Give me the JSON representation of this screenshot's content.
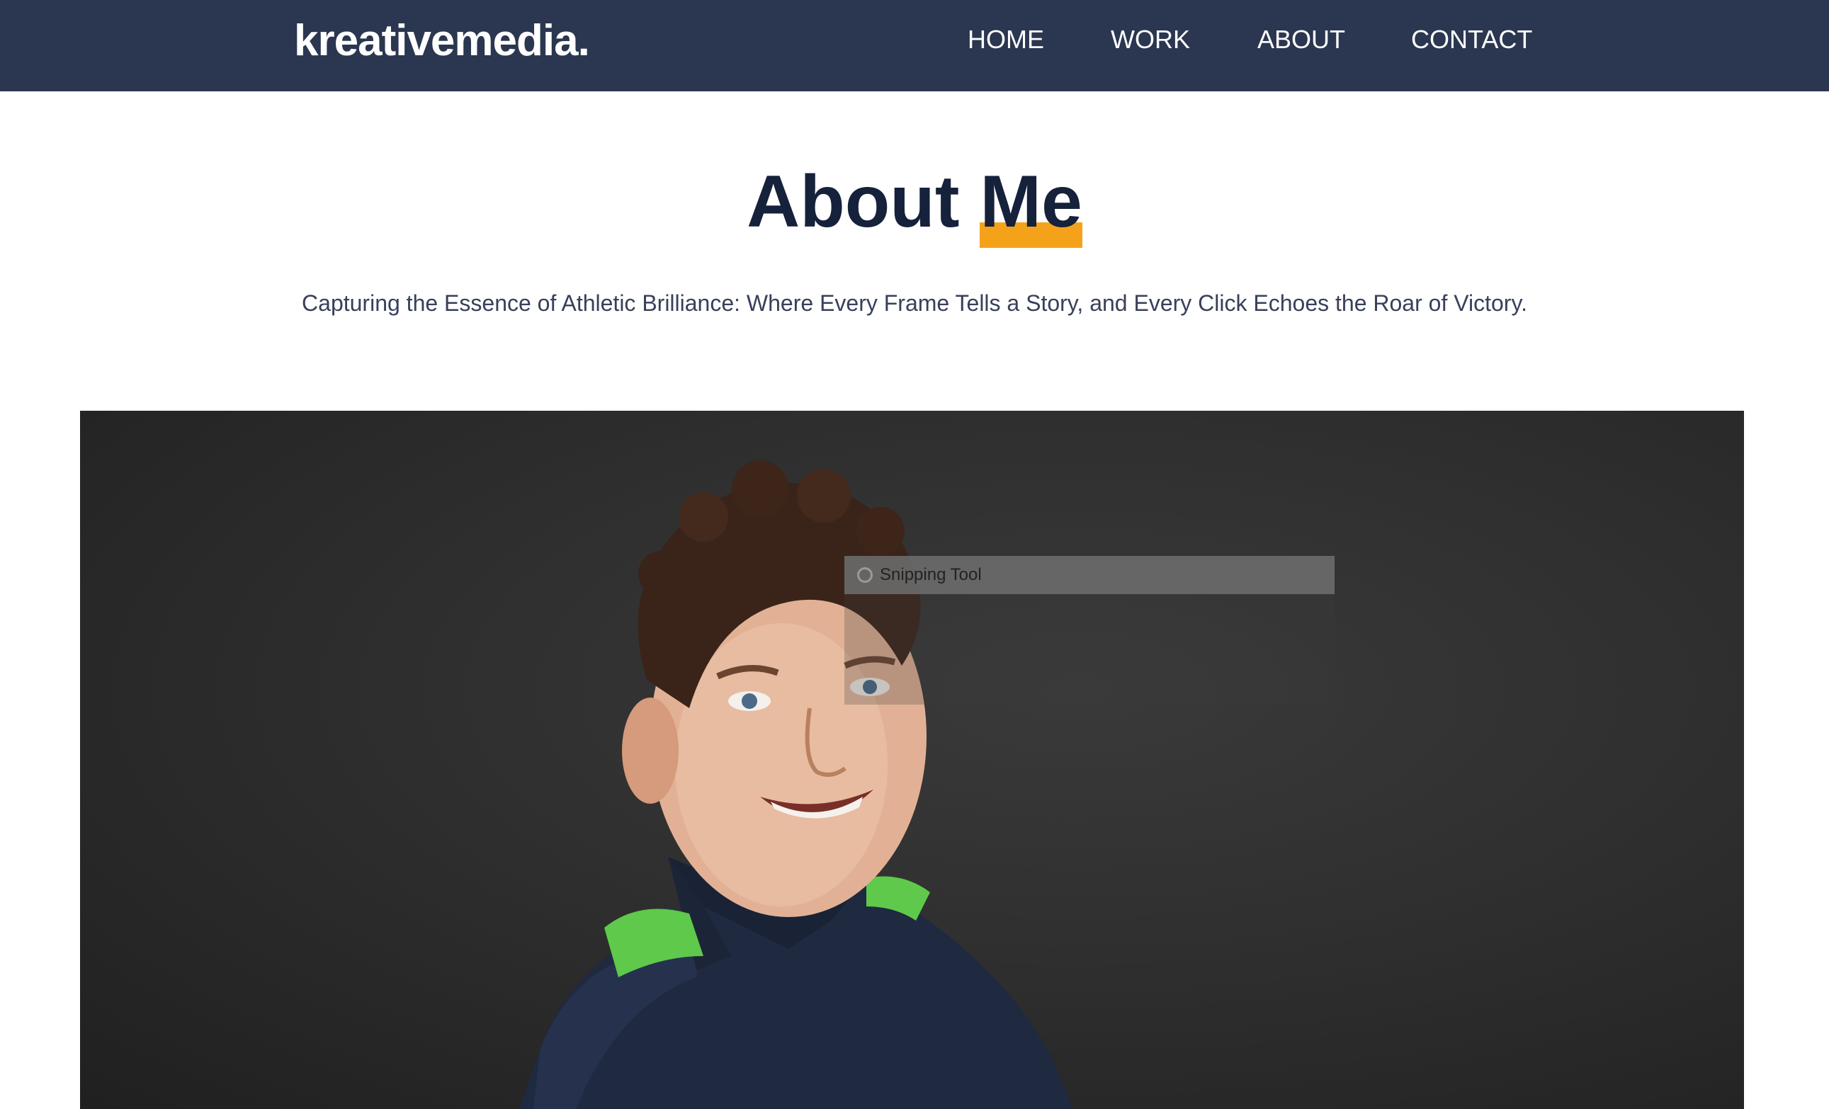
{
  "header": {
    "logo": {
      "part1": "kreative",
      "part2": "media",
      "dot": "."
    },
    "nav": [
      "HOME",
      "WORK",
      "ABOUT",
      "CONTACT"
    ]
  },
  "hero": {
    "title_start": "About",
    "title_highlight": "Me",
    "subtitle": "Capturing the Essence of Athletic Brilliance: Where Every Frame Tells a Story, and Every Click Echoes the Roar of Victory."
  },
  "overlay": {
    "snipping_tool_label": "Snipping Tool"
  },
  "colors": {
    "header_bg": "#2b3650",
    "accent": "#f5a21b",
    "title": "#16213b"
  }
}
